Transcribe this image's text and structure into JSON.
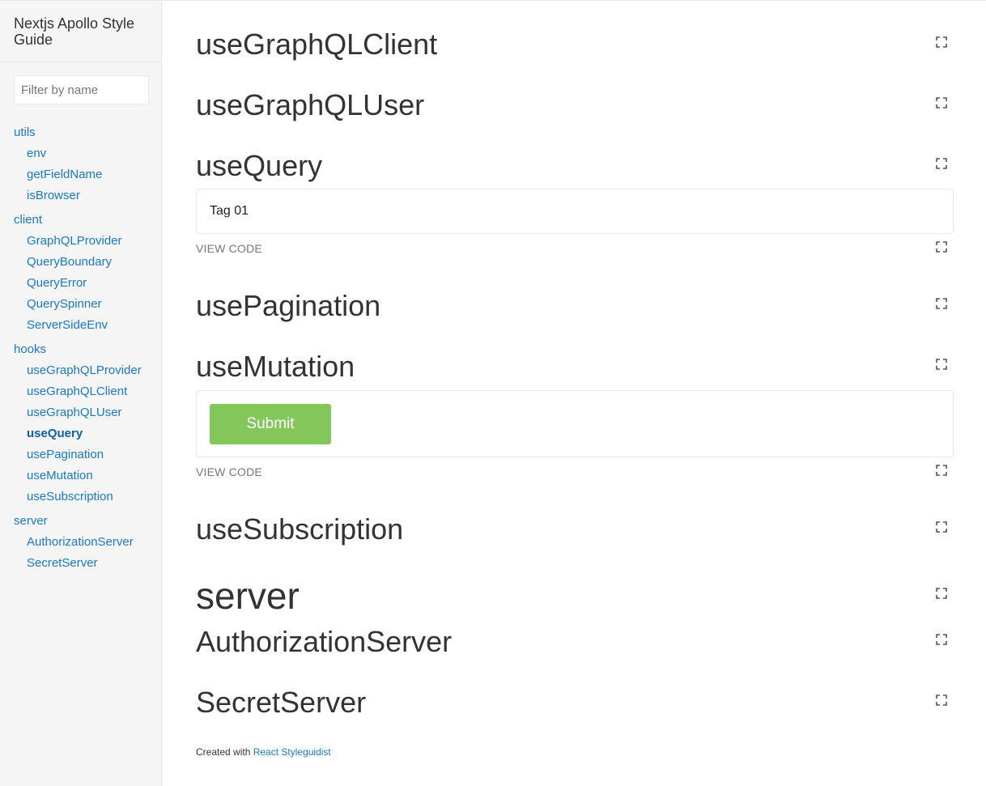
{
  "sidebar": {
    "title": "Nextjs Apollo Style Guide",
    "filter_placeholder": "Filter by name",
    "groups": [
      {
        "label": "utils",
        "items": [
          "env",
          "getFieldName",
          "isBrowser"
        ]
      },
      {
        "label": "client",
        "items": [
          "GraphQLProvider",
          "QueryBoundary",
          "QueryError",
          "QuerySpinner",
          "ServerSideEnv"
        ]
      },
      {
        "label": "hooks",
        "items": [
          "useGraphQLProvider",
          "useGraphQLClient",
          "useGraphQLUser",
          "useQuery",
          "usePagination",
          "useMutation",
          "useSubscription"
        ]
      },
      {
        "label": "server",
        "items": [
          "AuthorizationServer",
          "SecretServer"
        ]
      }
    ],
    "active_item": "useQuery"
  },
  "main": {
    "sections": {
      "useGraphQLClient": "useGraphQLClient",
      "useGraphQLUser": "useGraphQLUser",
      "useQuery": "useQuery",
      "usePagination": "usePagination",
      "useMutation": "useMutation",
      "useSubscription": "useSubscription",
      "server": "server",
      "AuthorizationServer": "AuthorizationServer",
      "SecretServer": "SecretServer"
    },
    "query_preview_text": "Tag 01",
    "mutation_button_label": "Submit",
    "view_code_label": "VIEW CODE"
  },
  "footer": {
    "prefix": "Created with",
    "link_label": "React Styleguidist"
  },
  "colors": {
    "link": "#1978c8",
    "button": "#83c75a",
    "sidebar_bg": "#f5f5f5"
  }
}
